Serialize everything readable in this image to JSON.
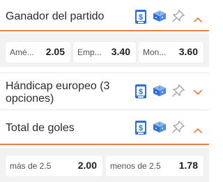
{
  "markets": [
    {
      "title": "Ganador del partido",
      "expanded": true,
      "outcomes": [
        {
          "label": "Amé...",
          "odds": "2.05"
        },
        {
          "label": "Emp...",
          "odds": "3.40"
        },
        {
          "label": "Mon...",
          "odds": "3.60"
        }
      ]
    },
    {
      "title_line1": "Hándicap europeo (3",
      "title_line2": "opciones)",
      "expanded": false
    },
    {
      "title": "Total de goles",
      "expanded": true,
      "outcomes": [
        {
          "label": "más de 2.5",
          "odds": "2.00"
        },
        {
          "label": "menos de 2.5",
          "odds": "1.78"
        }
      ]
    }
  ],
  "icons": {
    "cashout": "cashout-icon",
    "betbuilder": "bet-builder-cubes-icon",
    "pin": "pin-icon",
    "collapse": "chevron-up-icon",
    "expand": "chevron-down-icon"
  },
  "colors": {
    "accent": "#ef7b45",
    "icon_blue": "#2e6fd6",
    "icon_light_blue": "#8fb7e6",
    "pin_gray": "#a9a9a9",
    "panel_gray": "#f2f2f2"
  }
}
